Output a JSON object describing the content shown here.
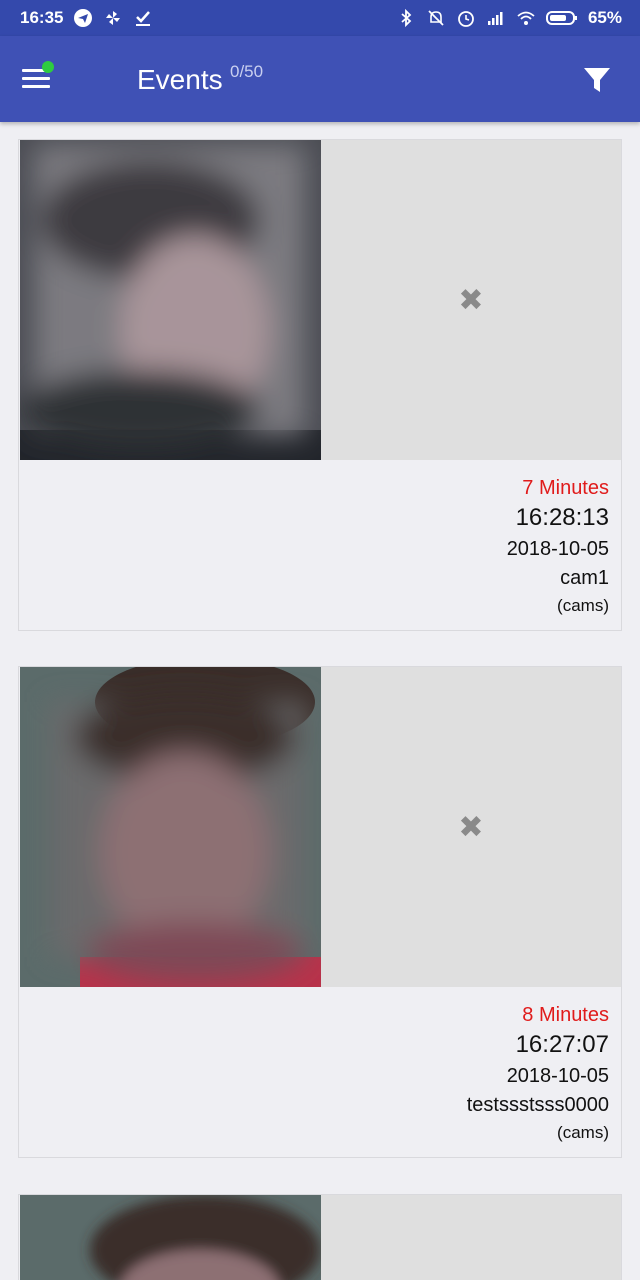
{
  "status_bar": {
    "time": "16:35",
    "battery": "65%",
    "icons_left": [
      "telegram-icon",
      "pinwheel-icon",
      "download-check-icon"
    ],
    "icons_right": [
      "bluetooth-icon",
      "mute-icon",
      "alarm-icon",
      "signal-icon",
      "wifi-icon",
      "battery-icon"
    ]
  },
  "appbar": {
    "title": "Events",
    "count": "0/50",
    "colors": {
      "appbar": "#3f51b5",
      "statusbar": "#3449ac",
      "accent_dot": "#2ecc40"
    }
  },
  "events": [
    {
      "ago": "7 Minutes",
      "time": "16:28:13",
      "date": "2018-10-05",
      "camera": "cam1",
      "group": "(cams)"
    },
    {
      "ago": "8 Minutes",
      "time": "16:27:07",
      "date": "2018-10-05",
      "camera": "testssstsss0000",
      "group": "(cams)"
    },
    {
      "ago": "",
      "time": "",
      "date": "",
      "camera": "",
      "group": ""
    }
  ],
  "colors": {
    "ago_text": "#e01b1b",
    "placeholder_bg": "#dfdfdf",
    "page_bg": "#efeff3"
  }
}
